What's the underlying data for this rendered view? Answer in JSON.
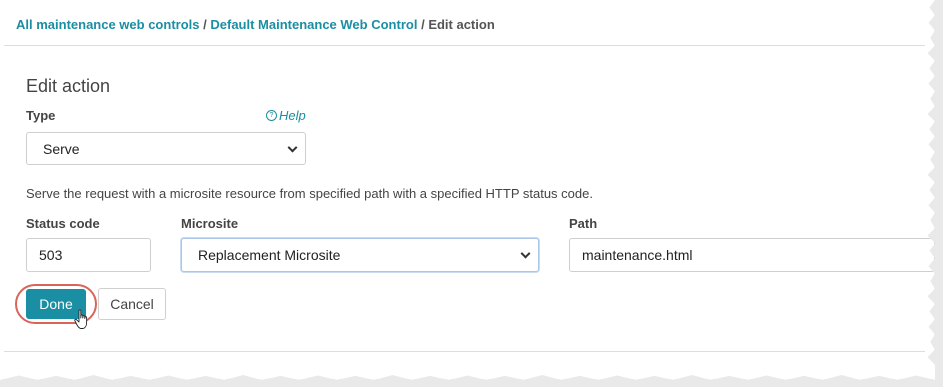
{
  "breadcrumb": {
    "link1": "All maintenance web controls",
    "link2": "Default Maintenance Web Control",
    "current": "Edit action",
    "separator": "/"
  },
  "form": {
    "heading": "Edit action",
    "type_label": "Type",
    "help_label": "Help",
    "type_value": "Serve",
    "description": "Serve the request with a microsite resource from specified path with a specified HTTP status code.",
    "status_code_label": "Status code",
    "status_code_value": "503",
    "microsite_label": "Microsite",
    "microsite_value": "Replacement Microsite",
    "path_label": "Path",
    "path_value": "maintenance.html"
  },
  "actions": {
    "done_label": "Done",
    "cancel_label": "Cancel"
  },
  "colors": {
    "accent": "#1a8ea3",
    "highlight_ring": "#d9655a"
  },
  "icons": {
    "help": "question-circle-icon",
    "chevron": "chevron-down-icon",
    "cursor": "hand-pointer-icon"
  }
}
